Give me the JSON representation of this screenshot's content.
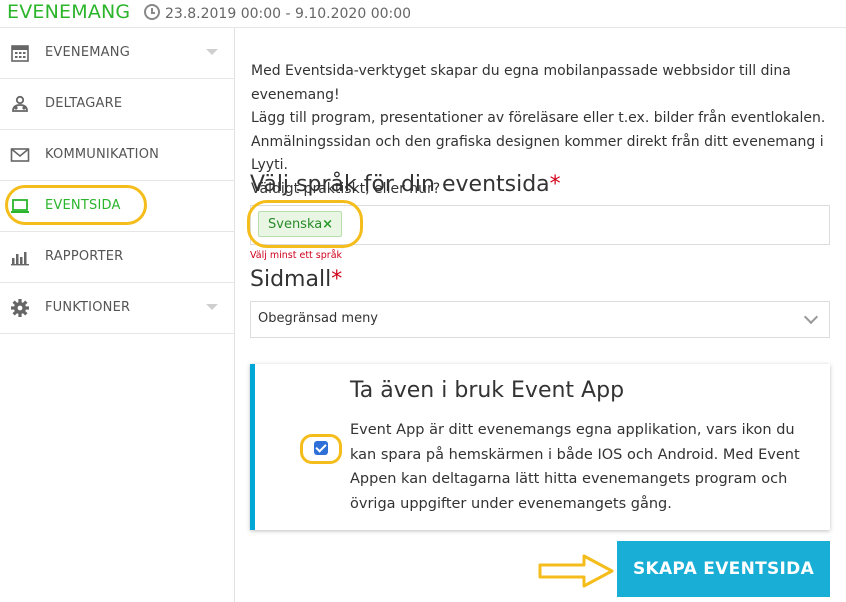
{
  "header": {
    "app_title": "EVENEMANG",
    "date_range": "23.8.2019 00:00 - 9.10.2020 00:00"
  },
  "sidebar": {
    "items": [
      {
        "label": "EVENEMANG",
        "icon": "calendar-icon",
        "has_dropdown": true
      },
      {
        "label": "DELTAGARE",
        "icon": "participants-icon"
      },
      {
        "label": "KOMMUNIKATION",
        "icon": "envelope-icon"
      },
      {
        "label": "EVENTSIDA",
        "icon": "laptop-icon",
        "active": true
      },
      {
        "label": "RAPPORTER",
        "icon": "bar-chart-icon"
      },
      {
        "label": "FUNKTIONER",
        "icon": "gear-icon",
        "has_dropdown": true
      }
    ]
  },
  "main": {
    "intro_lines": [
      "Med Eventsida-verktyget skapar du egna mobilanpassade webbsidor till dina evenemang!",
      "Lägg till program, presentationer av föreläsare eller t.ex. bilder från eventlokalen.",
      "Anmälningssidan och den grafiska designen kommer direkt från ditt evenemang i Lyyti.",
      "Väldigt praktiskt, eller hur?"
    ],
    "language_label": "Välj språk för din eventsida",
    "language_tag": "Svenska",
    "language_tag_remove": "×",
    "language_error": "Välj minst ett språk",
    "template_label": "Sidmall",
    "required_mark": "*",
    "template_value": "Obegränsad meny",
    "event_app": {
      "title": "Ta även i bruk Event App",
      "lines": [
        "Event App är ditt evenemangs egna applikation, vars ikon du",
        "kan spara på hemskärmen i både IOS och Android. Med Event",
        "Appen kan deltagarna lätt hitta evenemangets program och",
        "övriga uppgifter under evenemangets gång."
      ],
      "checked": true
    },
    "create_button": "SKAPA EVENTSIDA"
  },
  "colors": {
    "brand_green": "#2bb52b",
    "accent_blue": "#18aed6",
    "highlight_yellow": "#f4bd1c",
    "error_red": "#d0021b"
  }
}
